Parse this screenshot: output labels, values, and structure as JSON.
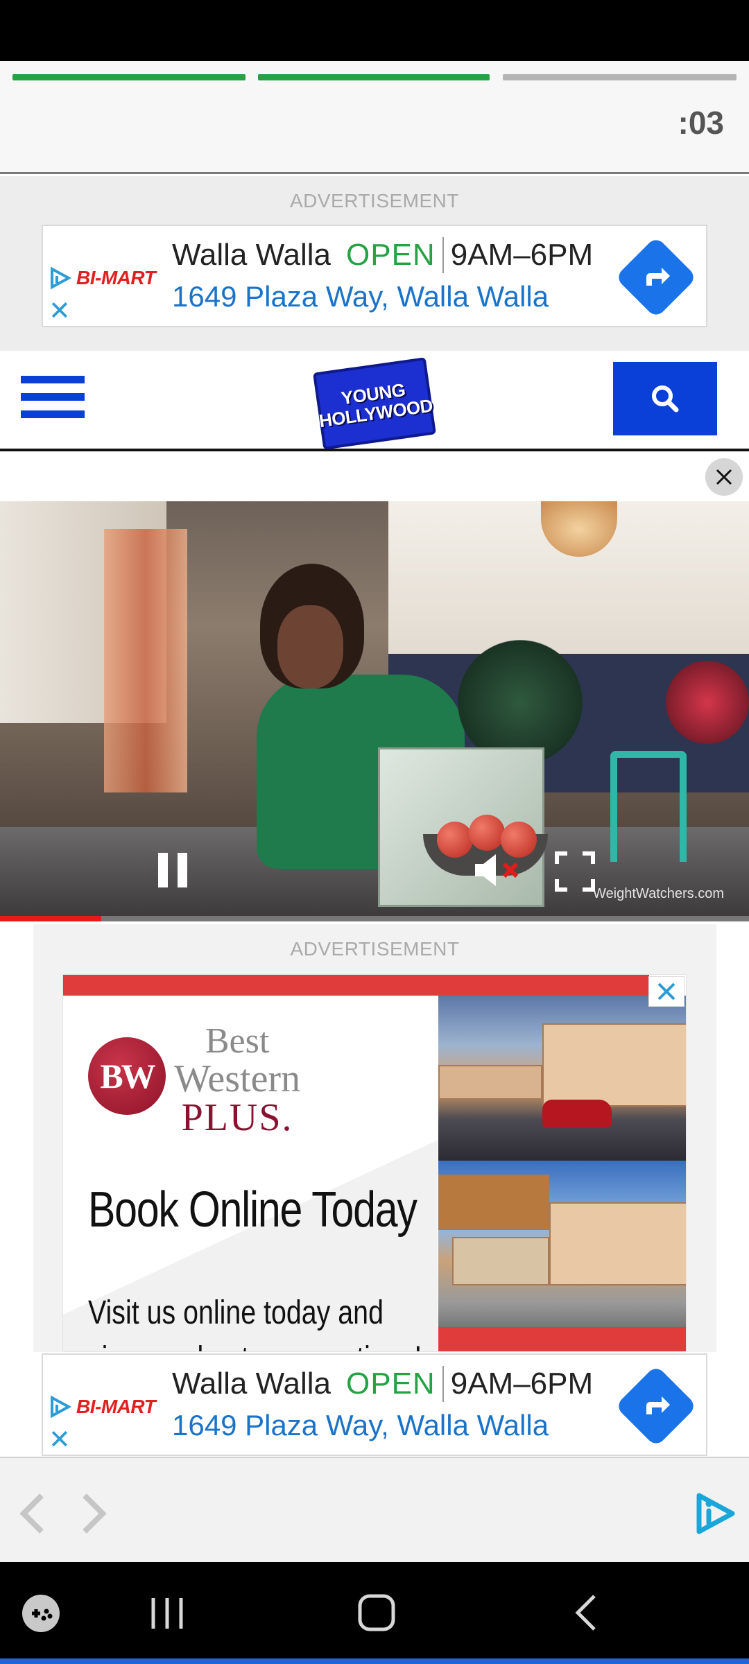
{
  "story": {
    "progress_segments": [
      1,
      1,
      0
    ],
    "timer": ":03"
  },
  "ads": {
    "label": "ADVERTISEMENT",
    "bimart": {
      "brand": "BI-MART",
      "city": "Walla Walla",
      "status": "OPEN",
      "hours": "9AM–6PM",
      "address": "1649 Plaza Way, Walla Walla"
    },
    "bestwestern": {
      "logo_text": "BW",
      "brand_line1": "Best",
      "brand_line2": "Western",
      "brand_line3": "PLUS.",
      "headline": "Book Online Today",
      "body": "Visit us online today and",
      "body2": "view our best room options!"
    }
  },
  "header": {
    "logo_line1": "YOUNG",
    "logo_line2": "HOLLYWOOD"
  },
  "video": {
    "watermark": "WeightWatchers.com",
    "progress": 0.135,
    "muted": true,
    "playing": true
  },
  "colors": {
    "progress_done": "#25a244",
    "progress_pending": "#b4b4b4",
    "brand_blue": "#0a3fd8",
    "video_progress": "#e21b1b"
  }
}
